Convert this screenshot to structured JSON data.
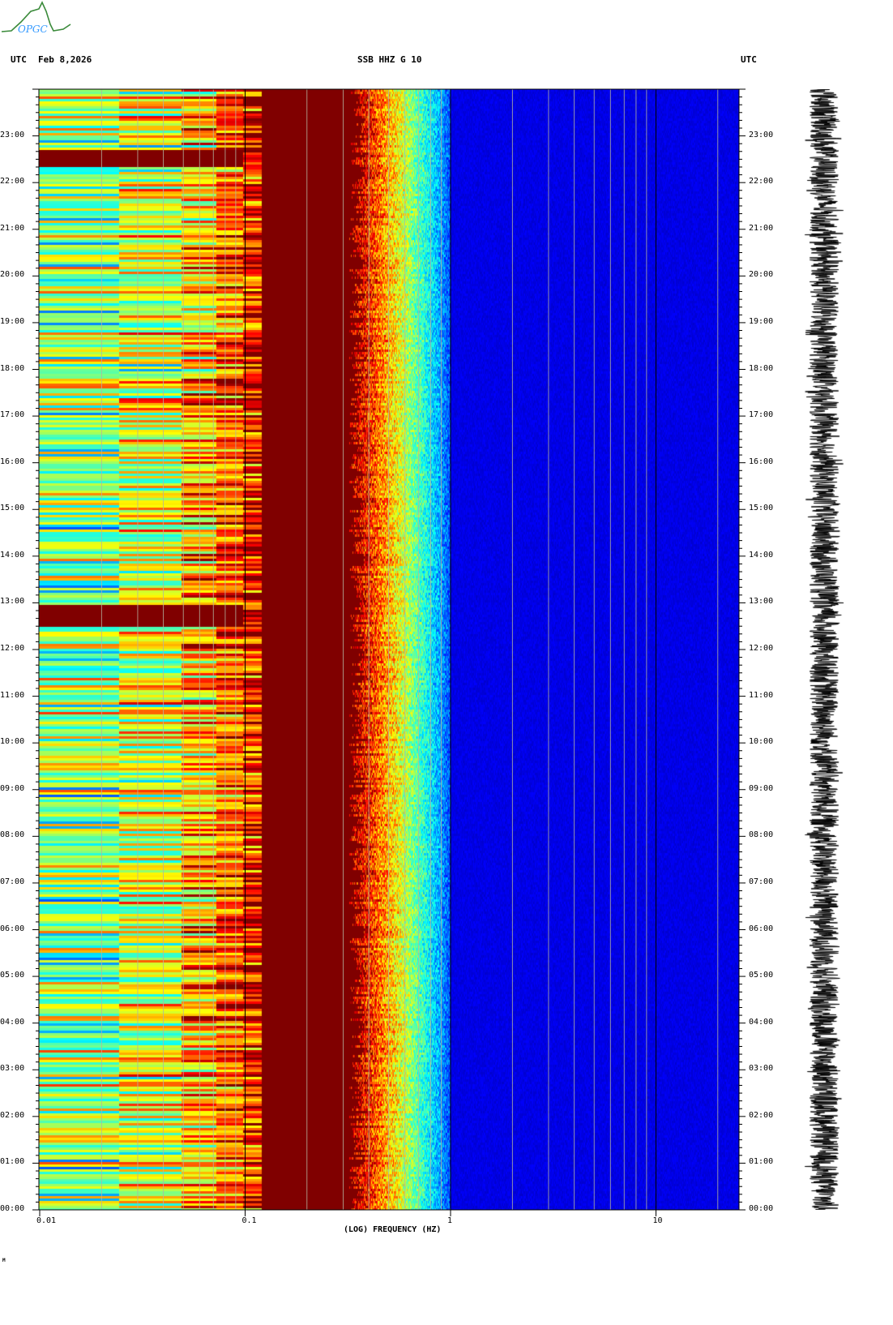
{
  "header": {
    "left_tz": "UTC",
    "date": "Feb 8,2026",
    "station": "SSB HHZ G 10",
    "right_tz": "UTC"
  },
  "logo": {
    "text": "OPGC"
  },
  "chart_data": {
    "type": "heatmap",
    "title": "SSB HHZ G 10",
    "xlabel": "(LOG) FREQUENCY (HZ)",
    "ylabel": "UTC",
    "xscale": "log",
    "xlim": [
      0.01,
      25
    ],
    "ylim_hours": [
      0,
      24
    ],
    "x_ticks": [
      {
        "value": 0.01,
        "label": "0.01"
      },
      {
        "value": 0.1,
        "label": "0.1"
      },
      {
        "value": 1,
        "label": "1"
      },
      {
        "value": 10,
        "label": "10"
      }
    ],
    "y_ticks": [
      "00:00",
      "01:00",
      "02:00",
      "03:00",
      "04:00",
      "05:00",
      "06:00",
      "07:00",
      "08:00",
      "09:00",
      "10:00",
      "11:00",
      "12:00",
      "13:00",
      "14:00",
      "15:00",
      "16:00",
      "17:00",
      "18:00",
      "19:00",
      "20:00",
      "21:00",
      "22:00",
      "23:00"
    ],
    "colormap": "jet",
    "high_power_band_hz": [
      0.12,
      0.3
    ],
    "noise_falloff_hz": [
      0.3,
      1.0
    ],
    "events_hours": [
      [
        22.35,
        22.7
      ],
      [
        12.5,
        13.0
      ]
    ],
    "grid": true
  },
  "footer": {
    "mark": "M"
  }
}
